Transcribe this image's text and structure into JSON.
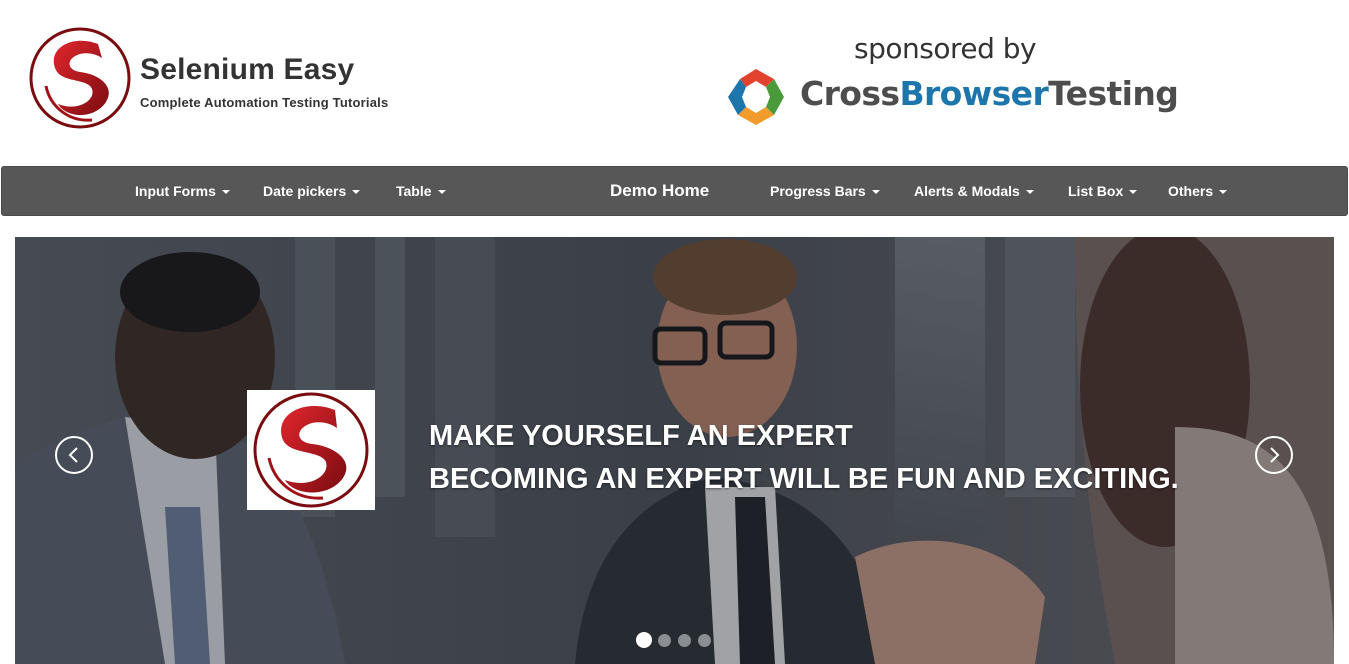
{
  "brand": {
    "title": "Selenium Easy",
    "tagline": "Complete Automation Testing Tutorials",
    "logo_icon": "selenium-easy-s-logo",
    "colors": {
      "logo_red": "#c8141b",
      "logo_dark_red": "#7a0c10"
    }
  },
  "sponsor": {
    "label": "sponsored by",
    "name_part1": "Cross",
    "name_part2": "Browser",
    "name_part3": "Testing",
    "logo_icon": "crossbrowsertesting-logo",
    "colors": {
      "gray": "#4d4d4d",
      "blue": "#1c76ab",
      "red": "#e2432f",
      "green": "#4a9a3c",
      "orange": "#f39b2c"
    }
  },
  "navbar": {
    "background": "#575757",
    "items_left": [
      {
        "label": "Input Forms",
        "caret": true
      },
      {
        "label": "Date pickers",
        "caret": true
      },
      {
        "label": "Table",
        "caret": true
      }
    ],
    "home": {
      "label": "Demo Home"
    },
    "items_right": [
      {
        "label": "Progress Bars",
        "caret": true
      },
      {
        "label": "Alerts & Modals",
        "caret": true
      },
      {
        "label": "List Box",
        "caret": true
      },
      {
        "label": "Others",
        "caret": true
      }
    ]
  },
  "carousel": {
    "caption_line1": "MAKE YOURSELF AN EXPERT",
    "caption_line2": "BECOMING AN EXPERT WILL BE FUN AND EXCITING.",
    "prev_icon": "chevron-left-icon",
    "next_icon": "chevron-right-icon",
    "slide_count": 4,
    "active_slide": 1
  }
}
